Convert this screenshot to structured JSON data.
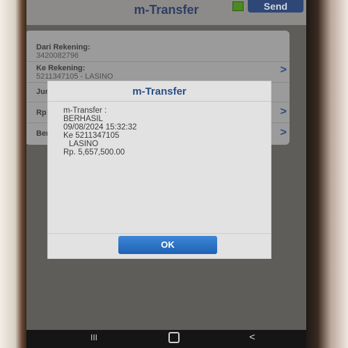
{
  "app": {
    "title": "m-Transfer",
    "send_label": "Send"
  },
  "form": {
    "rows": [
      {
        "label": "Dari Rekening:",
        "value": "3420082796"
      },
      {
        "label": "Ke Rekening:",
        "value": "5211347105 - LASINO"
      },
      {
        "label": "Jumi",
        "value": ""
      },
      {
        "label": "Rp",
        "value": ""
      },
      {
        "label": "Berit",
        "value": ""
      }
    ]
  },
  "dialog": {
    "title": "m-Transfer",
    "lines": [
      "m-Transfer :",
      "BERHASIL",
      "09/08/2024 15:32:32",
      "Ke 5211347105",
      "LASINO",
      "Rp. 5,657,500.00"
    ],
    "ok_label": "OK"
  },
  "navbar": {
    "recent_glyph": "III",
    "back_glyph": "<"
  },
  "chevron_glyph": ">"
}
